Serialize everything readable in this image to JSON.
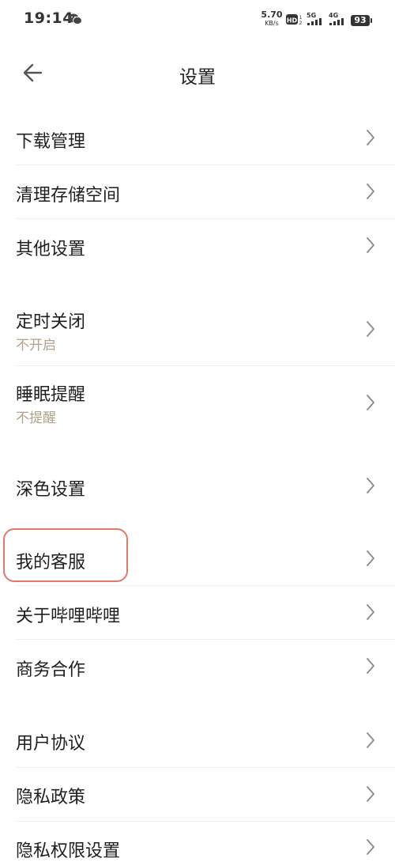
{
  "status_bar": {
    "time": "19:14",
    "net_speed_value": "5.70",
    "net_speed_unit": "KB/s",
    "signal_1": "5G",
    "signal_2": "4G",
    "battery": "93"
  },
  "header": {
    "title": "设置"
  },
  "rows": [
    {
      "label": "下载管理"
    },
    {
      "label": "清理存储空间"
    },
    {
      "label": "其他设置"
    },
    {
      "label": "定时关闭",
      "sub": "不开启"
    },
    {
      "label": "睡眠提醒",
      "sub": "不提醒"
    },
    {
      "label": "深色设置"
    },
    {
      "label": "我的客服"
    },
    {
      "label": "关于哔哩哔哩"
    },
    {
      "label": "商务合作"
    },
    {
      "label": "用户协议"
    },
    {
      "label": "隐私政策"
    },
    {
      "label": "隐私权限设置"
    }
  ],
  "colors": {
    "accent_sub": "#b0a288",
    "highlight": "#e2786a",
    "icon": "#555555"
  },
  "icons": {
    "back": "arrow-left-icon",
    "chevron": "chevron-right-icon"
  }
}
